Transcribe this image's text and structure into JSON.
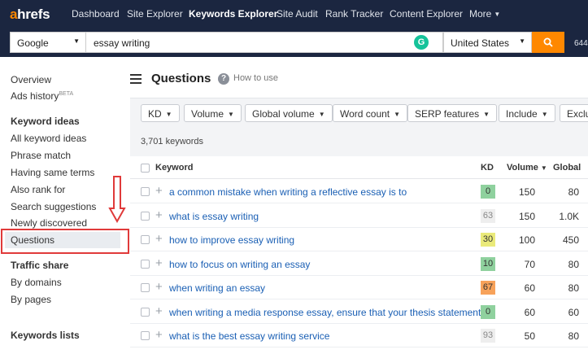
{
  "nav": {
    "logo_a": "a",
    "logo_rest": "hrefs",
    "items": [
      "Dashboard",
      "Site Explorer",
      "Keywords Explorer",
      "Site Audit",
      "Rank Tracker",
      "Content Explorer",
      "More"
    ]
  },
  "search": {
    "engine": "Google",
    "query": "essay writing",
    "country": "United States",
    "truncated_text": "644"
  },
  "sidebar": {
    "items_top": [
      "Overview",
      "Ads history"
    ],
    "beta": "BETA",
    "keyword_ideas_head": "Keyword ideas",
    "keyword_ideas": [
      "All keyword ideas",
      "Phrase match",
      "Having same terms",
      "Also rank for",
      "Search suggestions",
      "Newly discovered",
      "Questions"
    ],
    "traffic_share_head": "Traffic share",
    "traffic_share": [
      "By domains",
      "By pages"
    ],
    "keywords_lists_head": "Keywords lists"
  },
  "main": {
    "title": "Questions",
    "howto": "How to use",
    "filters": [
      "KD",
      "Volume",
      "Global volume",
      "Word count",
      "SERP features",
      "Include",
      "Exclu"
    ],
    "keyword_count": "3,701 keywords",
    "columns": {
      "keyword": "Keyword",
      "kd": "KD",
      "volume": "Volume",
      "global": "Global"
    }
  },
  "rows": [
    {
      "keyword": "a common mistake when writing a reflective essay is to",
      "kd": "0",
      "kd_color": "#8fd19e",
      "volume": "150",
      "global": "80"
    },
    {
      "keyword": "what is essay writing",
      "kd": "63",
      "kd_color": "#eeeeee",
      "volume": "150",
      "global": "1.0K"
    },
    {
      "keyword": "how to improve essay writing",
      "kd": "30",
      "kd_color": "#eaea7a",
      "volume": "100",
      "global": "450"
    },
    {
      "keyword": "how to focus on writing an essay",
      "kd": "10",
      "kd_color": "#8fd19e",
      "volume": "70",
      "global": "80"
    },
    {
      "keyword": "when writing an essay",
      "kd": "67",
      "kd_color": "#f7a25a",
      "volume": "60",
      "global": "80"
    },
    {
      "keyword": "when writing a media response essay, ensure that your thesis statement",
      "kd": "0",
      "kd_color": "#8fd19e",
      "volume": "60",
      "global": "60"
    },
    {
      "keyword": "what is the best essay writing service",
      "kd": "93",
      "kd_color": "#eeeeee",
      "volume": "50",
      "global": "80"
    }
  ]
}
